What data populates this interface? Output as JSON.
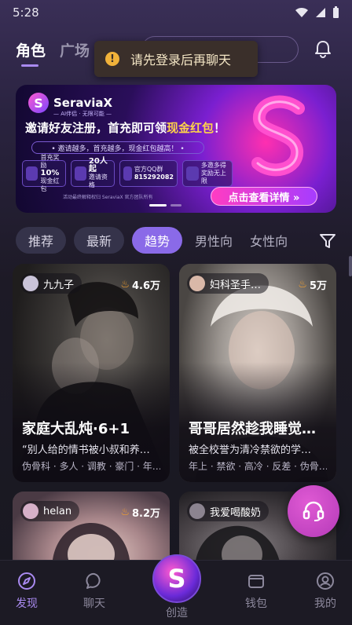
{
  "status": {
    "time": "5:28"
  },
  "header": {
    "tabs": [
      {
        "label": "角色"
      },
      {
        "label": "广场"
      }
    ]
  },
  "toast": {
    "text": "请先登录后再聊天"
  },
  "banner": {
    "brand": "SeraviaX",
    "brand_sub": "— AI伴侣 · 无限可能 —",
    "title_a": "邀请好友注册，首充即可领",
    "title_b": "现金红包",
    "title_c": "！",
    "line": "• 邀请越多，首充越多，现金红包越高！ •",
    "perks": [
      {
        "top": "首充奖励",
        "big": "10%",
        "bottom": "现金红包"
      },
      {
        "top": "",
        "big": "20人起",
        "bottom": "邀请资格"
      },
      {
        "top": "官方QQ群",
        "big": "815292082",
        "bottom": ""
      },
      {
        "top": "多邀多得",
        "big": "",
        "bottom": "奖励无上限"
      }
    ],
    "foot": "活动最终解释权归 SeraviaX 官方团队所有",
    "cta": "点击查看详情 »"
  },
  "filters": [
    {
      "label": "推荐"
    },
    {
      "label": "最新"
    },
    {
      "label": "趋势"
    },
    {
      "label": "男性向"
    },
    {
      "label": "女性向"
    }
  ],
  "cards": [
    {
      "author": "九九子",
      "heat": "4.6万",
      "title": "家庭大乱炖·6+1",
      "desc": "“别人给的情书被小叔和养…",
      "tags": "伪骨科 · 多人 · 调教 · 豪门 · 年…"
    },
    {
      "author": "妇科圣手…",
      "heat": "5万",
      "title": "哥哥居然趁我睡觉…",
      "desc": "被全校誉为清冷禁欲的学…",
      "tags": "年上 · 禁欲 · 高冷 · 反差 · 伪骨…"
    },
    {
      "author": "helan",
      "heat": "8.2万"
    },
    {
      "author": "我爱喝酸奶",
      "heat": ""
    }
  ],
  "nav": {
    "discover": "发现",
    "chat": "聊天",
    "create": "创造",
    "wallet": "钱包",
    "me": "我的"
  },
  "colors": {
    "accent": "#a98af0",
    "chip_active": "#8a6ae8",
    "fab": "#c445c4",
    "toast_icon": "#f0b23a"
  }
}
